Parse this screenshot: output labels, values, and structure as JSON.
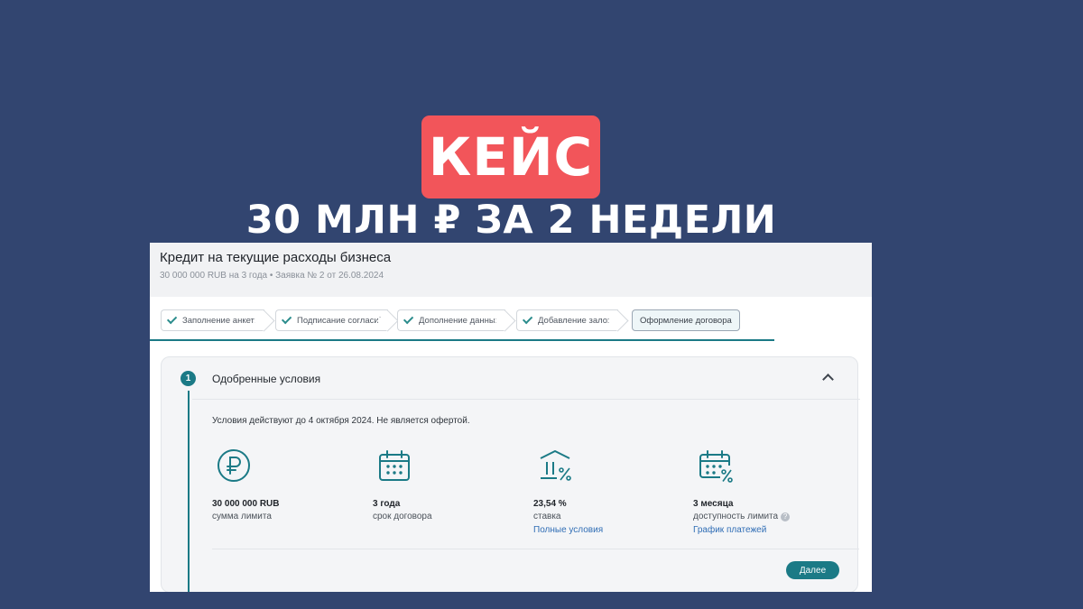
{
  "banner": {
    "badge": "КЕЙС",
    "headline": "30 МЛН ₽ ЗА 2 НЕДЕЛИ"
  },
  "panel": {
    "title": "Кредит на текущие расходы бизнеса",
    "subtitle": "30 000 000 RUB на 3 года • Заявка № 2 от 26.08.2024",
    "steps": [
      {
        "label": "Заполнение анкеты",
        "done": true
      },
      {
        "label": "Подписание согласий",
        "done": true
      },
      {
        "label": "Дополнение данных",
        "done": true
      },
      {
        "label": "Добавление залога",
        "done": true
      },
      {
        "label": "Оформление договора",
        "done": false
      }
    ],
    "card": {
      "step_number": "1",
      "title": "Одобренные условия",
      "note": "Условия действуют до 4 октября 2024. Не является офертой.",
      "stats": [
        {
          "icon": "ruble-icon",
          "value": "30 000 000 RUB",
          "label": "сумма лимита",
          "link": ""
        },
        {
          "icon": "calendar-icon",
          "value": "3 года",
          "label": "срок договора",
          "link": ""
        },
        {
          "icon": "bank-percent-icon",
          "value": "23,54 %",
          "label": "ставка",
          "link": "Полные условия"
        },
        {
          "icon": "calendar-percent-icon",
          "value": "3 месяца",
          "label": "доступность лимита",
          "link": "График платежей"
        }
      ],
      "next_label": "Далее"
    }
  },
  "colors": {
    "background": "#324570",
    "badge": "#f2555a",
    "accent": "#1b7a86",
    "link": "#2f6db5"
  }
}
